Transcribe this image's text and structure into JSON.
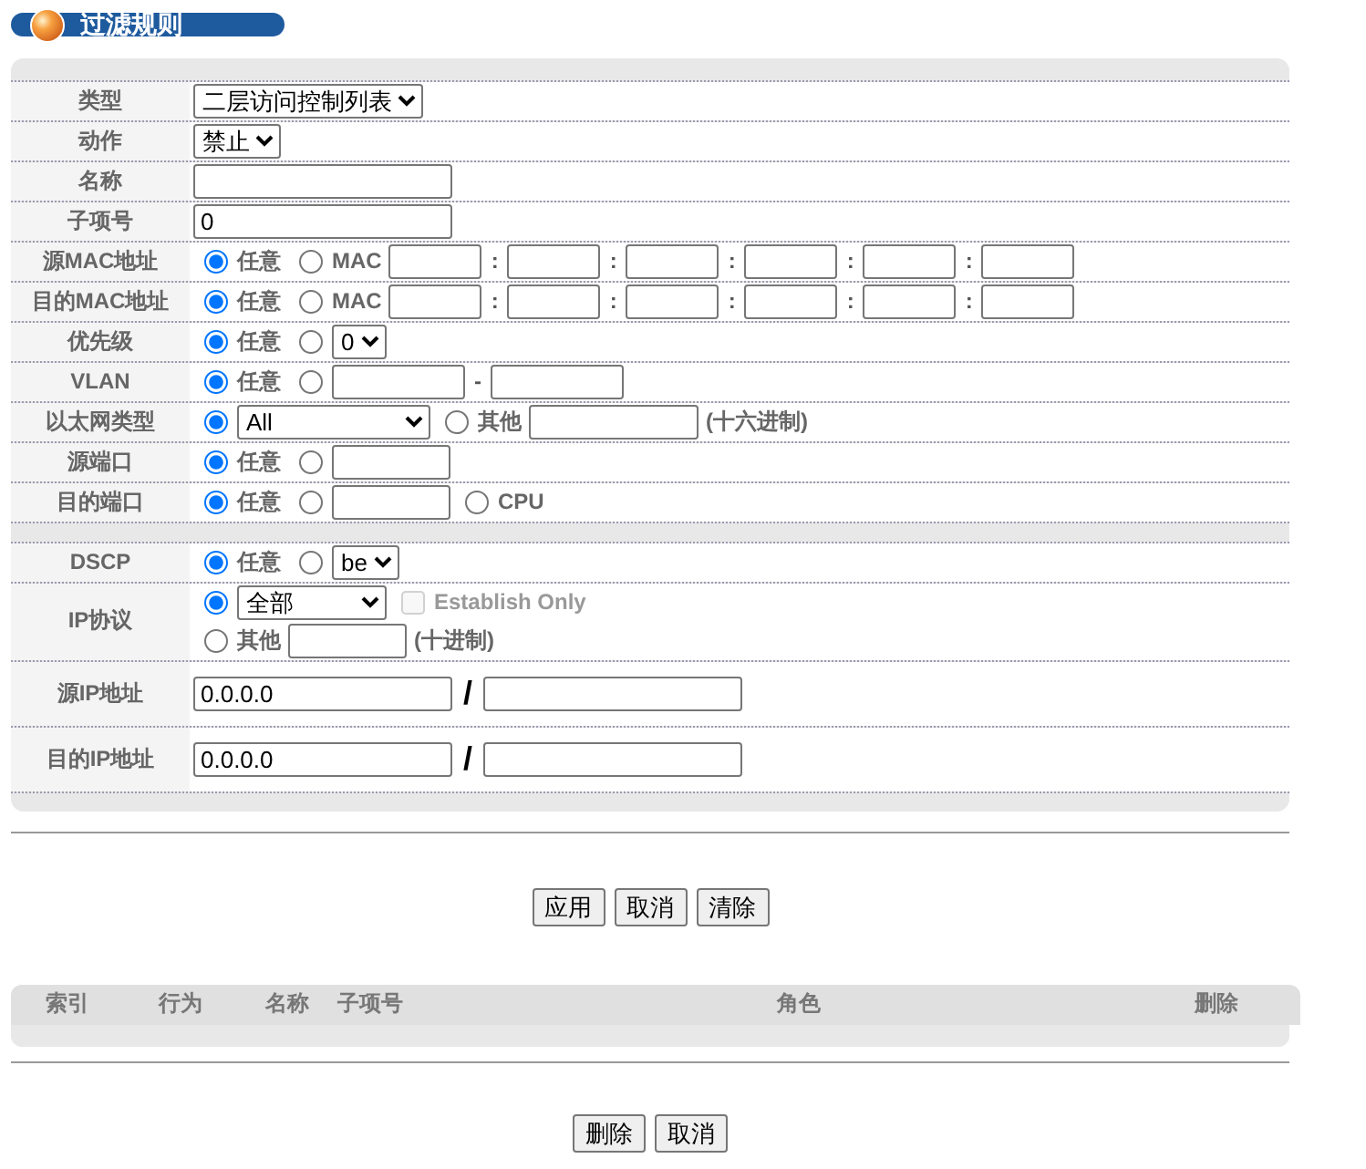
{
  "title": "过滤规则",
  "sections": [
    {
      "rows": [
        {
          "label": "类型",
          "kind": "field",
          "lines": [
            [
              {
                "kind": "select",
                "value": "二层访问控制列表"
              }
            ]
          ]
        },
        {
          "label": "动作",
          "kind": "field",
          "lines": [
            [
              {
                "kind": "select",
                "value": "禁止"
              }
            ]
          ]
        },
        {
          "label": "名称",
          "kind": "field",
          "lines": [
            [
              {
                "kind": "input"
              }
            ]
          ]
        },
        {
          "label": "子项号",
          "kind": "field",
          "lines": [
            [
              {
                "kind": "input",
                "value": "0"
              }
            ]
          ]
        },
        {
          "label": "源MAC地址",
          "kind": "field",
          "lines": [
            [
              {
                "kind": "radio",
                "label": "任意",
                "selected": true
              },
              {
                "kind": "radio",
                "label": "MAC",
                "selected": false
              },
              {
                "kind": "octet"
              },
              {
                "kind": "sep",
                "text": ":"
              },
              {
                "kind": "octet"
              },
              {
                "kind": "sep",
                "text": ":"
              },
              {
                "kind": "octet"
              },
              {
                "kind": "sep",
                "text": ":"
              },
              {
                "kind": "octet"
              },
              {
                "kind": "sep",
                "text": ":"
              },
              {
                "kind": "octet"
              },
              {
                "kind": "sep",
                "text": ":"
              },
              {
                "kind": "octet"
              }
            ]
          ]
        },
        {
          "label": "目的MAC地址",
          "kind": "field",
          "lines": [
            [
              {
                "kind": "radio",
                "label": "任意",
                "selected": true
              },
              {
                "kind": "radio",
                "label": "MAC",
                "selected": false
              },
              {
                "kind": "octet"
              },
              {
                "kind": "sep",
                "text": ":"
              },
              {
                "kind": "octet"
              },
              {
                "kind": "sep",
                "text": ":"
              },
              {
                "kind": "octet"
              },
              {
                "kind": "sep",
                "text": ":"
              },
              {
                "kind": "octet"
              },
              {
                "kind": "sep",
                "text": ":"
              },
              {
                "kind": "octet"
              },
              {
                "kind": "sep",
                "text": ":"
              },
              {
                "kind": "octet"
              }
            ]
          ]
        },
        {
          "label": "优先级",
          "kind": "field",
          "lines": [
            [
              {
                "kind": "radio",
                "label": "任意",
                "selected": true
              },
              {
                "kind": "radio",
                "selected": false
              },
              {
                "kind": "select",
                "value": "0"
              }
            ]
          ]
        },
        {
          "label": "VLAN",
          "kind": "field",
          "lines": [
            [
              {
                "kind": "radio",
                "label": "任意",
                "selected": true
              },
              {
                "kind": "radio",
                "selected": false
              },
              {
                "kind": "mid"
              },
              {
                "kind": "sep",
                "text": "-"
              },
              {
                "kind": "mid"
              }
            ]
          ]
        },
        {
          "label": "以太网类型",
          "kind": "field",
          "lines": [
            [
              {
                "kind": "radio",
                "selected": true
              },
              {
                "kind": "wide-select",
                "value": "All"
              },
              {
                "kind": "radio",
                "label": "其他",
                "selected": false
              },
              {
                "kind": "mid-long"
              },
              {
                "kind": "note",
                "text": "(十六进制)"
              }
            ]
          ]
        },
        {
          "label": "源端口",
          "kind": "field",
          "lines": [
            [
              {
                "kind": "radio",
                "label": "任意",
                "selected": true
              },
              {
                "kind": "radio",
                "selected": false
              },
              {
                "kind": "short"
              }
            ]
          ]
        },
        {
          "label": "目的端口",
          "kind": "field",
          "lines": [
            [
              {
                "kind": "radio",
                "label": "任意",
                "selected": true
              },
              {
                "kind": "radio",
                "selected": false
              },
              {
                "kind": "short"
              },
              {
                "kind": "radio",
                "label": "CPU",
                "selected": false
              }
            ]
          ]
        }
      ]
    },
    {
      "rows": [
        {
          "label": "DSCP",
          "kind": "field",
          "lines": [
            [
              {
                "kind": "radio",
                "label": "任意",
                "selected": true
              },
              {
                "kind": "radio",
                "selected": false
              },
              {
                "kind": "select",
                "value": "be"
              }
            ]
          ]
        },
        {
          "label": "IP协议",
          "kind": "field",
          "lines": [
            [
              {
                "kind": "radio",
                "selected": true
              },
              {
                "kind": "mid-select",
                "value": "全部"
              },
              {
                "kind": "checkbox",
                "label": "Establish Only",
                "checked": false,
                "disabled": true
              }
            ],
            [
              {
                "kind": "radio",
                "label": "其他",
                "selected": false
              },
              {
                "kind": "short"
              },
              {
                "kind": "note",
                "text": "(十进制)"
              }
            ]
          ]
        },
        {
          "label": "源IP地址",
          "kind": "address",
          "lines": [
            [
              {
                "kind": "input",
                "value": "0.0.0.0"
              },
              {
                "kind": "slash",
                "text": "/"
              },
              {
                "kind": "input"
              }
            ]
          ]
        },
        {
          "label": "目的IP地址",
          "kind": "address",
          "lines": [
            [
              {
                "kind": "input",
                "value": "0.0.0.0"
              },
              {
                "kind": "slash",
                "text": "/"
              },
              {
                "kind": "input"
              }
            ]
          ]
        }
      ]
    }
  ],
  "buttons": [
    "应用",
    "取消",
    "清除"
  ],
  "table": {
    "columns": [
      "索引",
      "行为",
      "名称",
      "子项号",
      "角色",
      "删除"
    ]
  },
  "table_buttons": [
    "删除",
    "取消"
  ]
}
